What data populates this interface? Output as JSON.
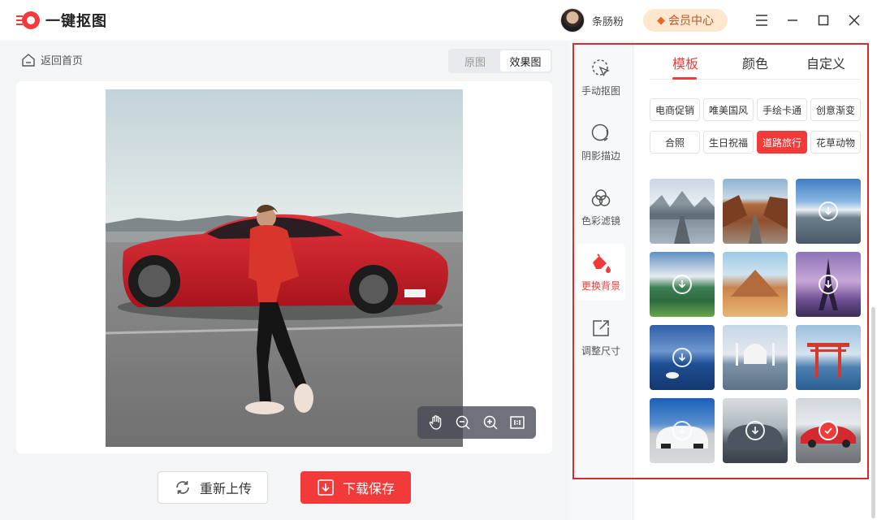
{
  "app": {
    "title": "一键抠图",
    "brand_color": "#f23a3a"
  },
  "user": {
    "name": "条肠粉"
  },
  "header": {
    "vip_label": "会员中心"
  },
  "window_controls": [
    "menu-icon",
    "minimize-icon",
    "maximize-icon",
    "close-icon"
  ],
  "editor": {
    "back_label": "返回首页",
    "view_toggle": {
      "options": [
        "原图",
        "效果图"
      ],
      "selected": "效果图"
    },
    "zoom_tools": [
      "hand-icon",
      "zoom-out-icon",
      "zoom-in-icon",
      "actual-size-icon"
    ],
    "reupload_label": "重新上传",
    "save_label": "下载保存"
  },
  "tools": [
    {
      "label": "手动抠图",
      "icon": "manual-cutout-icon"
    },
    {
      "label": "阴影描边",
      "icon": "shadow-outline-icon"
    },
    {
      "label": "色彩滤镜",
      "icon": "color-filter-icon"
    },
    {
      "label": "更换背景",
      "icon": "change-background-icon",
      "active": true
    },
    {
      "label": "调整尺寸",
      "icon": "resize-icon"
    }
  ],
  "tabs": {
    "items": [
      "模板",
      "颜色",
      "自定义"
    ],
    "selected": "模板"
  },
  "categories": {
    "items": [
      "电商促销",
      "唯美国风",
      "手绘卡通",
      "创意渐变",
      "合照",
      "生日祝福",
      "道路旅行",
      "花草动物"
    ],
    "selected": "道路旅行"
  },
  "templates": [
    {
      "name": "snowy-forest-road",
      "state": "ready"
    },
    {
      "name": "canyon-road",
      "state": "ready"
    },
    {
      "name": "snow-mountain-road",
      "state": "download"
    },
    {
      "name": "green-valley-lake",
      "state": "download"
    },
    {
      "name": "desert-mountain",
      "state": "ready"
    },
    {
      "name": "eiffel-tower",
      "state": "download"
    },
    {
      "name": "swan-lake",
      "state": "download"
    },
    {
      "name": "taj-mahal",
      "state": "ready"
    },
    {
      "name": "torii-gate",
      "state": "ready"
    },
    {
      "name": "white-sports-car",
      "state": "download"
    },
    {
      "name": "grey-muscle-car",
      "state": "download"
    },
    {
      "name": "red-sports-car",
      "state": "selected"
    }
  ]
}
